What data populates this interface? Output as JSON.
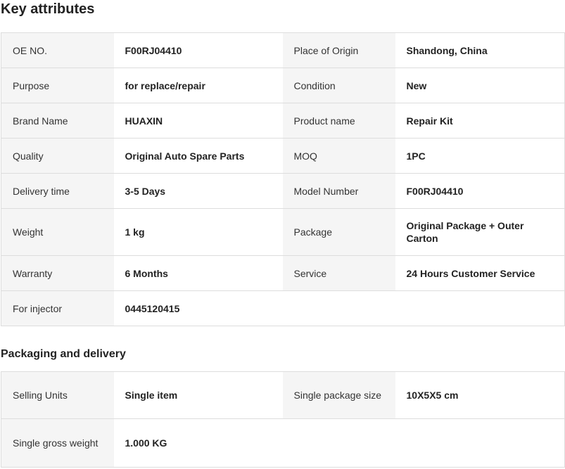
{
  "key_attributes": {
    "title": "Key attributes",
    "rows": [
      {
        "l1": "OE NO.",
        "v1": "F00RJ04410",
        "l2": "Place of Origin",
        "v2": "Shandong, China"
      },
      {
        "l1": "Purpose",
        "v1": "for replace/repair",
        "l2": "Condition",
        "v2": "New"
      },
      {
        "l1": "Brand Name",
        "v1": "HUAXIN",
        "l2": "Product name",
        "v2": "Repair Kit"
      },
      {
        "l1": "Quality",
        "v1": "Original Auto Spare Parts",
        "l2": "MOQ",
        "v2": "1PC"
      },
      {
        "l1": "Delivery time",
        "v1": "3-5 Days",
        "l2": "Model Number",
        "v2": "F00RJ04410"
      },
      {
        "l1": "Weight",
        "v1": "1 kg",
        "l2": "Package",
        "v2": "Original Package + Outer Carton"
      },
      {
        "l1": "Warranty",
        "v1": "6 Months",
        "l2": "Service",
        "v2": "24 Hours Customer Service"
      },
      {
        "l1": "For injector",
        "v1": "0445120415"
      }
    ]
  },
  "packaging": {
    "title": "Packaging and delivery",
    "rows": [
      {
        "l1": "Selling Units",
        "v1": "Single item",
        "l2": "Single package size",
        "v2": "10X5X5 cm"
      },
      {
        "l1": "Single gross weight",
        "v1": "1.000 KG"
      }
    ]
  }
}
